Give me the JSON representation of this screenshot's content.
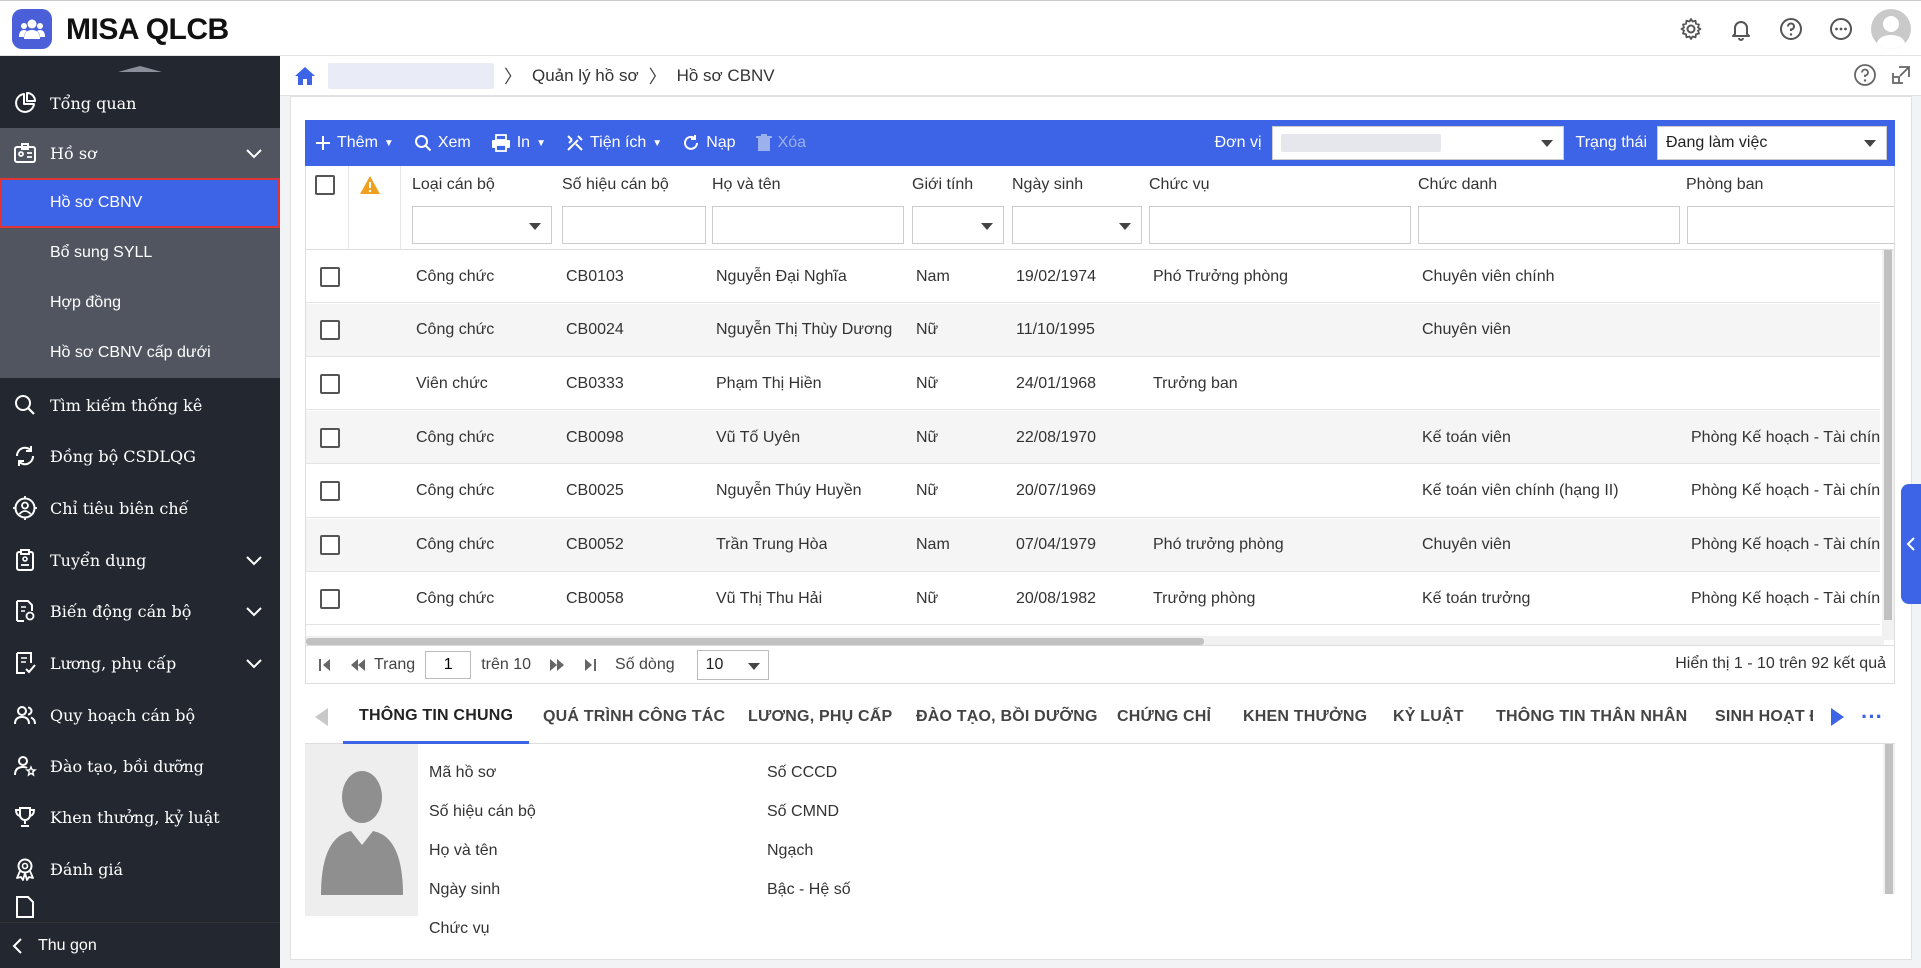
{
  "app": {
    "title": "MISA QLCB"
  },
  "breadcrumb": {
    "items": [
      "Quản lý hồ sơ",
      "Hồ sơ CBNV"
    ]
  },
  "sidebar": {
    "items": [
      {
        "label": "Tổng quan",
        "icon": "pie-chart-icon"
      },
      {
        "label": "Hồ sơ",
        "icon": "id-card-icon"
      },
      {
        "label": "Tìm kiếm thống kê",
        "icon": "search-icon"
      },
      {
        "label": "Đồng bộ CSDLQG",
        "icon": "sync-icon"
      },
      {
        "label": "Chỉ tiêu biên chế",
        "icon": "target-user-icon"
      },
      {
        "label": "Tuyển dụng",
        "icon": "clipboard-icon"
      },
      {
        "label": "Biến động cán bộ",
        "icon": "doc-gear-icon"
      },
      {
        "label": "Lương, phụ cấp",
        "icon": "payroll-icon"
      },
      {
        "label": "Quy hoạch cán bộ",
        "icon": "users-icon"
      },
      {
        "label": "Đào tạo, bồi dưỡng",
        "icon": "user-star-icon"
      },
      {
        "label": "Khen thưởng, kỷ luật",
        "icon": "trophy-icon"
      },
      {
        "label": "Đánh giá",
        "icon": "award-icon"
      }
    ],
    "subitems": [
      "Hồ sơ CBNV",
      "Bổ sung SYLL",
      "Hợp đồng",
      "Hồ sơ CBNV cấp dưới"
    ],
    "collapse_label": "Thu gọn"
  },
  "toolbar": {
    "add": "Thêm",
    "view": "Xem",
    "print": "In",
    "utilities": "Tiện ích",
    "reload": "Nạp",
    "delete": "Xóa",
    "unit_label": "Đơn vị",
    "status_label": "Trạng thái",
    "status_value": "Đang làm việc"
  },
  "grid": {
    "columns": [
      "Loại cán bộ",
      "Số hiệu cán bộ",
      "Họ và tên",
      "Giới tính",
      "Ngày sinh",
      "Chức vụ",
      "Chức danh",
      "Phòng ban"
    ],
    "rows": [
      [
        "Công chức",
        "CB0103",
        "Nguyễn Đại Nghĩa",
        "Nam",
        "19/02/1974",
        "Phó Trưởng phòng",
        "Chuyên viên chính",
        ""
      ],
      [
        "Công chức",
        "CB0024",
        "Nguyễn Thị Thùy Dương",
        "Nữ",
        "11/10/1995",
        "",
        "Chuyên viên",
        ""
      ],
      [
        "Viên chức",
        "CB0333",
        "Phạm Thị Hiền",
        "Nữ",
        "24/01/1968",
        "Trưởng ban",
        "",
        ""
      ],
      [
        "Công chức",
        "CB0098",
        "Vũ Tố Uyên",
        "Nữ",
        "22/08/1970",
        "",
        "Kế toán viên",
        "Phòng Kế hoạch - Tài chính"
      ],
      [
        "Công chức",
        "CB0025",
        "Nguyễn Thúy Huyền",
        "Nữ",
        "20/07/1969",
        "",
        "Kế toán viên chính (hạng II)",
        "Phòng Kế hoạch - Tài chính"
      ],
      [
        "Công chức",
        "CB0052",
        "Trần Trung Hòa",
        "Nam",
        "07/04/1979",
        "Phó trưởng phòng",
        "Chuyên viên",
        "Phòng Kế hoạch - Tài chính"
      ],
      [
        "Công chức",
        "CB0058",
        "Vũ Thị Thu Hải",
        "Nữ",
        "20/08/1982",
        "Trưởng phòng",
        "Kế toán trưởng",
        "Phòng Kế hoạch - Tài chính"
      ]
    ]
  },
  "pager": {
    "page_label": "Trang",
    "page_value": "1",
    "of_label": "trên 10",
    "rows_label": "Số dòng",
    "rows_value": "10",
    "summary": "Hiển thị 1 - 10 trên 92 kết quả"
  },
  "detail": {
    "tabs": [
      "THÔNG TIN CHUNG",
      "QUÁ TRÌNH CÔNG TÁC",
      "LƯƠNG, PHỤ CẤP",
      "ĐÀO TẠO, BỒI DƯỠNG",
      "CHỨNG CHỈ",
      "KHEN THƯỞNG",
      "KỶ LUẬT",
      "THÔNG TIN THÂN NHÂN",
      "SINH HOẠT Đ"
    ],
    "fields_left": [
      "Mã hồ sơ",
      "Số hiệu cán bộ",
      "Họ và tên",
      "Ngày sinh",
      "Chức vụ"
    ],
    "fields_right": [
      "Số CCCD",
      "Số CMND",
      "Ngạch",
      "Bậc - Hệ số"
    ]
  },
  "colors": {
    "accent": "#3d63e6",
    "sidebar_bg": "#232830",
    "sidebar_sub_bg": "#50555f",
    "warning": "#f0a020"
  }
}
